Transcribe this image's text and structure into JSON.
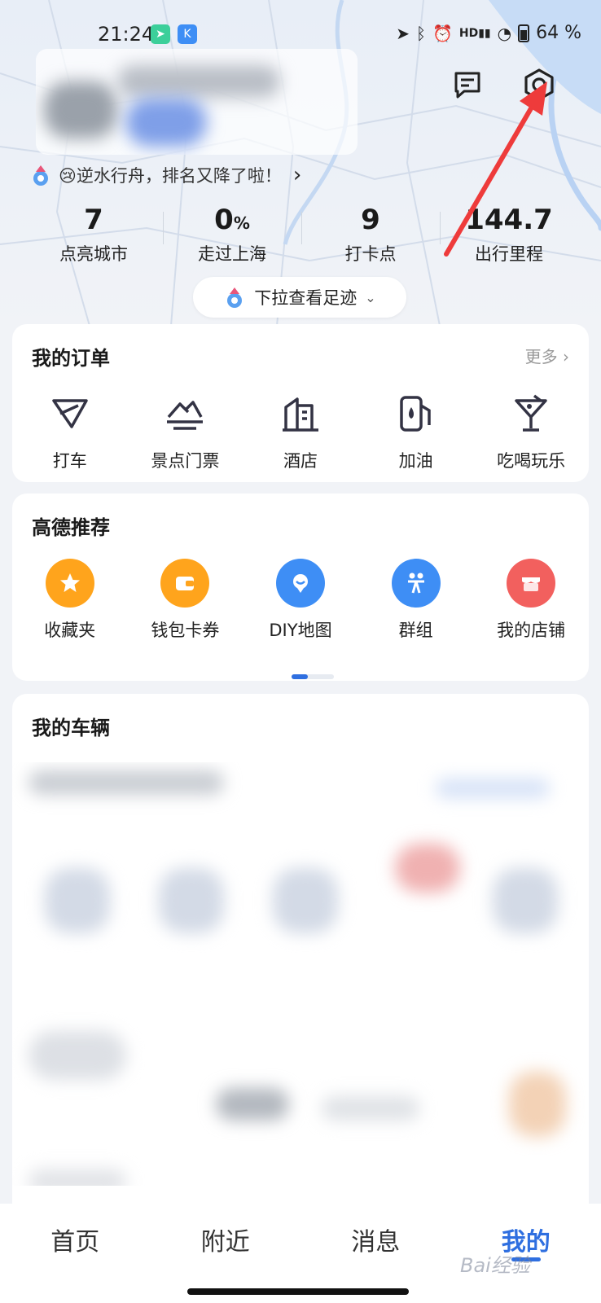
{
  "status_bar": {
    "time": "21:24",
    "battery_percent": "64 %",
    "icons": [
      "navigation-icon",
      "bluetooth-icon",
      "alarm-icon",
      "hd-signal-icon",
      "wifi-icon",
      "battery-icon"
    ]
  },
  "header": {
    "slogan": "😢逆水行舟，排名又降了啦！",
    "message_icon": "message-icon",
    "settings_icon": "settings-icon"
  },
  "stats": [
    {
      "value": "7",
      "unit": "",
      "label": "点亮城市"
    },
    {
      "value": "0",
      "unit": "%",
      "label": "走过上海"
    },
    {
      "value": "9",
      "unit": "",
      "label": "打卡点"
    },
    {
      "value": "144.7",
      "unit": "",
      "label": "出行里程"
    }
  ],
  "footprint": {
    "label": "下拉查看足迹"
  },
  "orders": {
    "title": "我的订单",
    "more": "更多",
    "items": [
      {
        "label": "打车",
        "icon": "taxi-icon"
      },
      {
        "label": "景点门票",
        "icon": "scenic-ticket-icon"
      },
      {
        "label": "酒店",
        "icon": "hotel-icon"
      },
      {
        "label": "加油",
        "icon": "fuel-icon"
      },
      {
        "label": "吃喝玩乐",
        "icon": "cocktail-icon"
      }
    ]
  },
  "recommend": {
    "title": "高德推荐",
    "items": [
      {
        "label": "收藏夹",
        "icon": "star-icon",
        "color": "#FFA41C"
      },
      {
        "label": "钱包卡券",
        "icon": "wallet-icon",
        "color": "#FFA41C"
      },
      {
        "label": "DIY地图",
        "icon": "diy-map-icon",
        "color": "#3E8EF5"
      },
      {
        "label": "群组",
        "icon": "group-icon",
        "color": "#3E8EF5"
      },
      {
        "label": "我的店铺",
        "icon": "shop-icon",
        "color": "#F2605E"
      }
    ]
  },
  "vehicles": {
    "title": "我的车辆"
  },
  "tabs": [
    {
      "label": "首页"
    },
    {
      "label": "附近"
    },
    {
      "label": "消息"
    },
    {
      "label": "我的",
      "active": true
    }
  ],
  "colors": {
    "accent": "#2F6FE0",
    "arrow": "#EE3B3B",
    "star": "#FFA41C",
    "shop": "#F2605E"
  }
}
